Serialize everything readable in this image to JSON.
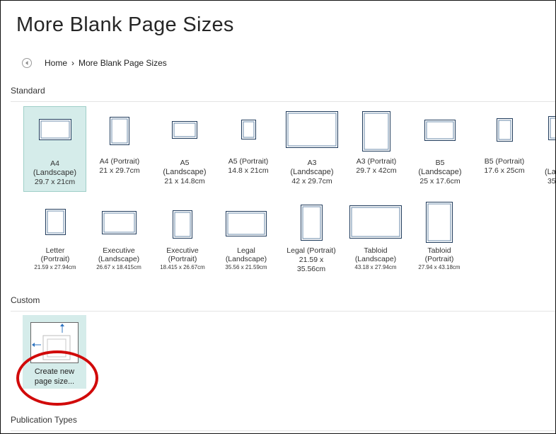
{
  "page": {
    "title": "More Blank Page Sizes"
  },
  "breadcrumb": {
    "home": "Home",
    "separator": "›",
    "current": "More Blank Page Sizes"
  },
  "sections": {
    "standard": "Standard",
    "custom": "Custom",
    "publication_types": "Publication Types"
  },
  "standard_row1": [
    {
      "line1": "A4",
      "line2": "(Landscape)",
      "line3": "29.7 x 21cm",
      "selected": true
    },
    {
      "line1": "A4 (Portrait)",
      "line2": "21 x 29.7cm",
      "line3": ""
    },
    {
      "line1": "A5",
      "line2": "(Landscape)",
      "line3": "21 x 14.8cm"
    },
    {
      "line1": "A5 (Portrait)",
      "line2": "14.8 x 21cm",
      "line3": ""
    },
    {
      "line1": "A3",
      "line2": "(Landscape)",
      "line3": "42 x 29.7cm"
    },
    {
      "line1": "A3 (Portrait)",
      "line2": "29.7 x 42cm",
      "line3": ""
    },
    {
      "line1": "B5",
      "line2": "(Landscape)",
      "line3": "25 x 17.6cm"
    },
    {
      "line1": "B5 (Portrait)",
      "line2": "17.6 x 25cm",
      "line3": ""
    },
    {
      "line1": "",
      "line2": "(La",
      "line3": "35"
    }
  ],
  "standard_row2": [
    {
      "line1": "Letter",
      "line2": "(Portrait)",
      "line3": "21.59 x 27.94cm"
    },
    {
      "line1": "Executive",
      "line2": "(Landscape)",
      "line3": "26.67 x 18.415cm"
    },
    {
      "line1": "Executive",
      "line2": "(Portrait)",
      "line3": "18.415 x 26.67cm"
    },
    {
      "line1": "Legal",
      "line2": "(Landscape)",
      "line3": "35.56 x 21.59cm"
    },
    {
      "line1": "Legal (Portrait)",
      "line2": "21.59 x",
      "line3": "35.56cm"
    },
    {
      "line1": "Tabloid",
      "line2": "(Landscape)",
      "line3": "43.18 x 27.94cm"
    },
    {
      "line1": "Tabloid",
      "line2": "(Portrait)",
      "line3": "27.94 x 43.18cm"
    }
  ],
  "custom": {
    "line1": "Create new",
    "line2": "page size..."
  },
  "icons": {
    "back": "back-arrow-icon",
    "page_size_custom": "custom-page-size-icon"
  },
  "colors": {
    "selected_bg": "#d5ecea",
    "thumb_border": "#1f3b5c",
    "highlight_circle": "#d10a0a"
  }
}
